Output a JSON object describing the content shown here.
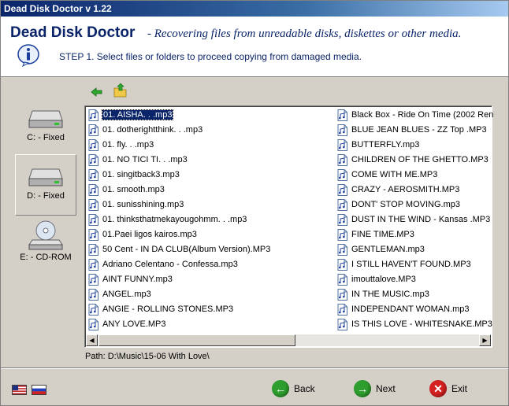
{
  "window": {
    "title": "Dead Disk Doctor v 1.22"
  },
  "header": {
    "app_name": "Dead Disk Doctor",
    "tagline": "- Recovering files from unreadable disks, diskettes or other media.",
    "step_text": "STEP 1.   Select files or folders to proceed copying from damaged media."
  },
  "drives": [
    {
      "label": "C: - Fixed",
      "icon": "hard-drive-icon",
      "selected": false
    },
    {
      "label": "D: - Fixed",
      "icon": "hard-drive-icon",
      "selected": true
    },
    {
      "label": "E: - CD-ROM",
      "icon": "cdrom-drive-icon",
      "selected": false
    }
  ],
  "files": {
    "column1": [
      "01. AISHA. . .mp3",
      "01. dotherightthink. . .mp3",
      "01. fly. . .mp3",
      "01. NO TICI TI. . .mp3",
      "01. singitback3.mp3",
      "01. smooth.mp3",
      "01. sunisshining.mp3",
      "01. thinksthatmekayougohmm. . .mp3",
      "01.Paei ligos kairos.mp3",
      "50 Cent  -  IN DA CLUB(Album Version).MP3",
      "Adriano Celentano - Confessa.mp3",
      "AINT FUNNY.mp3",
      "ANGEL.mp3",
      "ANGIE - ROLLING STONES.MP3",
      "ANY LOVE.MP3"
    ],
    "column2": [
      "Black Box  -  Ride On Time (2002 Ren",
      "BLUE JEAN BLUES - ZZ Top .MP3",
      "BUTTERFLY.mp3",
      "CHILDREN OF THE GHETTO.MP3",
      "COME WITH ME.MP3",
      "CRAZY - AEROSMITH.MP3",
      "DONT' STOP MOVING.mp3",
      "DUST IN THE WIND - Kansas .MP3",
      "FINE TIME.MP3",
      "GENTLEMAN.mp3",
      "I STILL HAVEN'T FOUND.MP3",
      "imouttalove.MP3",
      "IN THE MUSIC.mp3",
      "INDEPENDANT WOMAN.mp3",
      "IS THIS LOVE - WHITESNAKE.MP3"
    ],
    "selected": "01. AISHA. . .mp3"
  },
  "path_text": "Path: D:\\Music\\15-06 With Love\\",
  "buttons": {
    "back": "Back",
    "next": "Next",
    "exit": "Exit"
  },
  "colors": {
    "title_bar": "#0a246a",
    "selection": "#0a246a",
    "next_green": "#2e9e2e",
    "exit_red": "#d42020"
  }
}
